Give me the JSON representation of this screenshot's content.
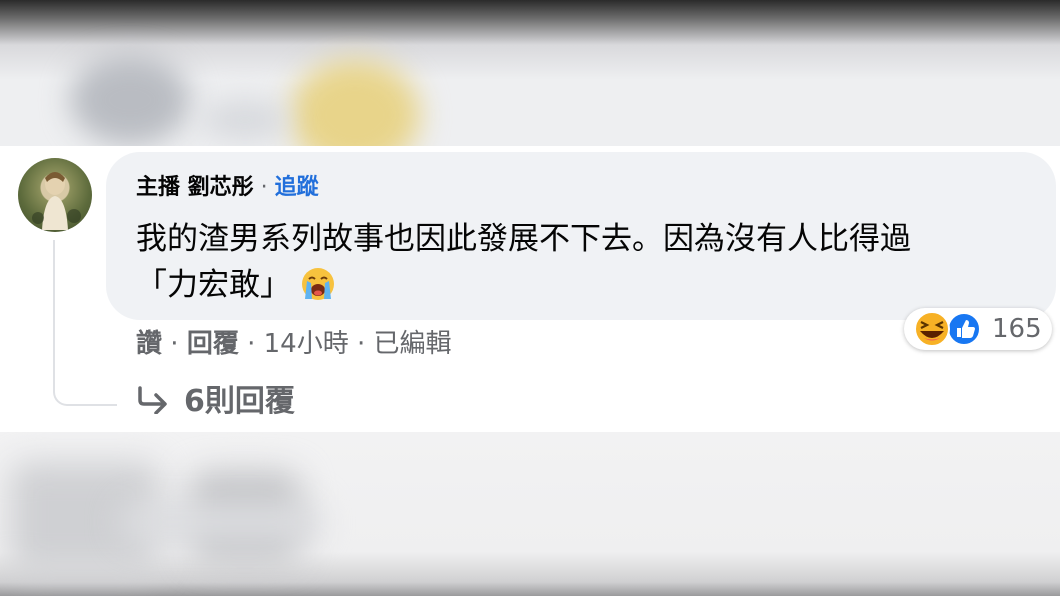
{
  "comment": {
    "author": "主播 劉芯彤",
    "separator": "·",
    "follow_label": "追蹤",
    "text_line1": "我的渣男系列故事也因此發展不下去。因為沒有人比得過",
    "text_line2": "「力宏敢」",
    "inline_emoji": "loudly-crying-face-icon",
    "actions": {
      "like": "讚",
      "dot1": " · ",
      "reply": "回覆",
      "dot2": " · ",
      "time": "14小時",
      "dot3": " · ",
      "edited": "已編輯"
    },
    "reactions": {
      "icons": [
        "haha-icon",
        "like-icon"
      ],
      "count": "165"
    },
    "replies_label": "6則回覆"
  },
  "colors": {
    "bubble": "#f0f2f5",
    "link_blue": "#216fdb",
    "meta_gray": "#65676b",
    "like_blue": "#1877f2",
    "haha_yellow": "#f7b125"
  }
}
